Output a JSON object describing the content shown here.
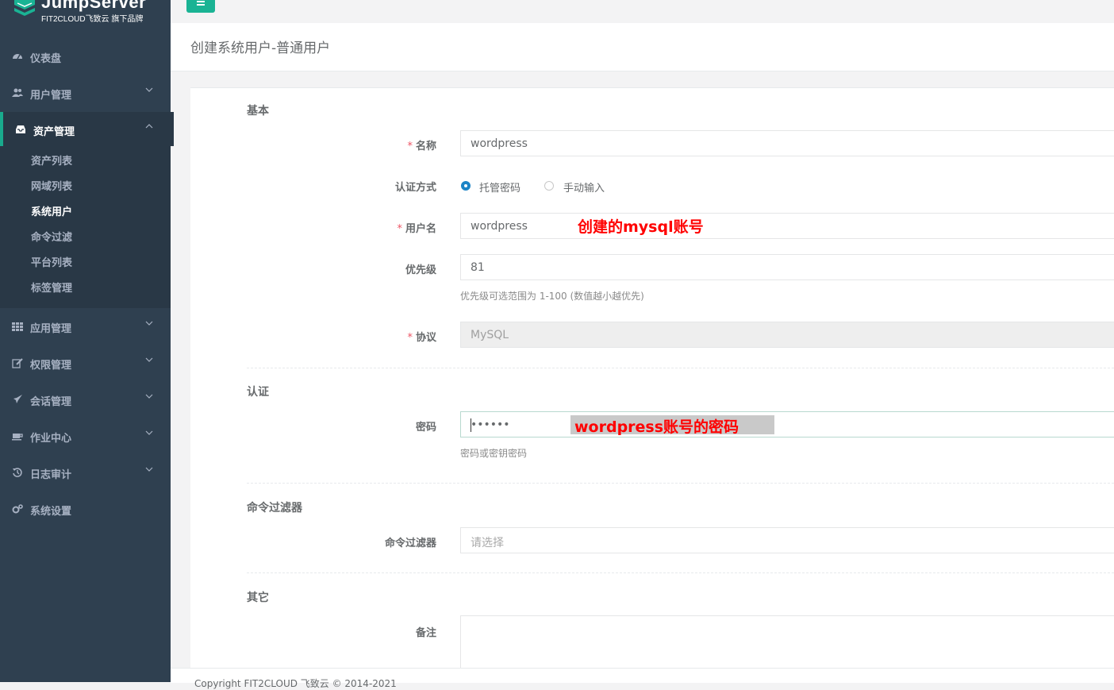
{
  "logo": {
    "title": "JumpServer",
    "subtitle": "FIT2CLOUD飞致云 旗下品牌"
  },
  "sidebar": {
    "items": [
      {
        "label": "仪表盘",
        "icon": "dashboard-icon"
      },
      {
        "label": "用户管理",
        "icon": "users-icon"
      },
      {
        "label": "资产管理",
        "icon": "inbox-icon"
      },
      {
        "label": "应用管理",
        "icon": "grid-icon"
      },
      {
        "label": "权限管理",
        "icon": "edit-icon"
      },
      {
        "label": "会话管理",
        "icon": "rocket-icon"
      },
      {
        "label": "作业中心",
        "icon": "coffee-icon"
      },
      {
        "label": "日志审计",
        "icon": "history-icon"
      },
      {
        "label": "系统设置",
        "icon": "gears-icon"
      }
    ],
    "submenu": [
      "资产列表",
      "网域列表",
      "系统用户",
      "命令过滤",
      "平台列表",
      "标签管理"
    ]
  },
  "header": {
    "title": "创建系统用户-普通用户"
  },
  "form": {
    "sections": {
      "basic": "基本",
      "auth": "认证",
      "filter": "命令过滤器",
      "other": "其它"
    },
    "name": {
      "label": "名称",
      "value": "wordpress"
    },
    "auth_method": {
      "label": "认证方式",
      "options": [
        "托管密码",
        "手动输入"
      ],
      "selected": "托管密码"
    },
    "username": {
      "label": "用户名",
      "value": "wordpress"
    },
    "priority": {
      "label": "优先级",
      "value": "81",
      "help": "优先级可选范围为 1-100 (数值越小越优先)"
    },
    "protocol": {
      "label": "协议",
      "value": "MySQL"
    },
    "password": {
      "label": "密码",
      "value": "••••••",
      "help": "密码或密钥密码"
    },
    "cmd_filter": {
      "label": "命令过滤器",
      "placeholder": "请选择"
    },
    "comment": {
      "label": "备注"
    }
  },
  "annotations": {
    "username_note": "创建的mysql账号",
    "password_note": "wordpress账号的密码"
  },
  "footer": {
    "copyright": "Copyright FIT2CLOUD 飞致云 © 2014-2021"
  },
  "colors": {
    "sidebar": "#2f4050",
    "accent": "#1ab394",
    "required": "#ed5565",
    "annotation": "#ff0000"
  }
}
